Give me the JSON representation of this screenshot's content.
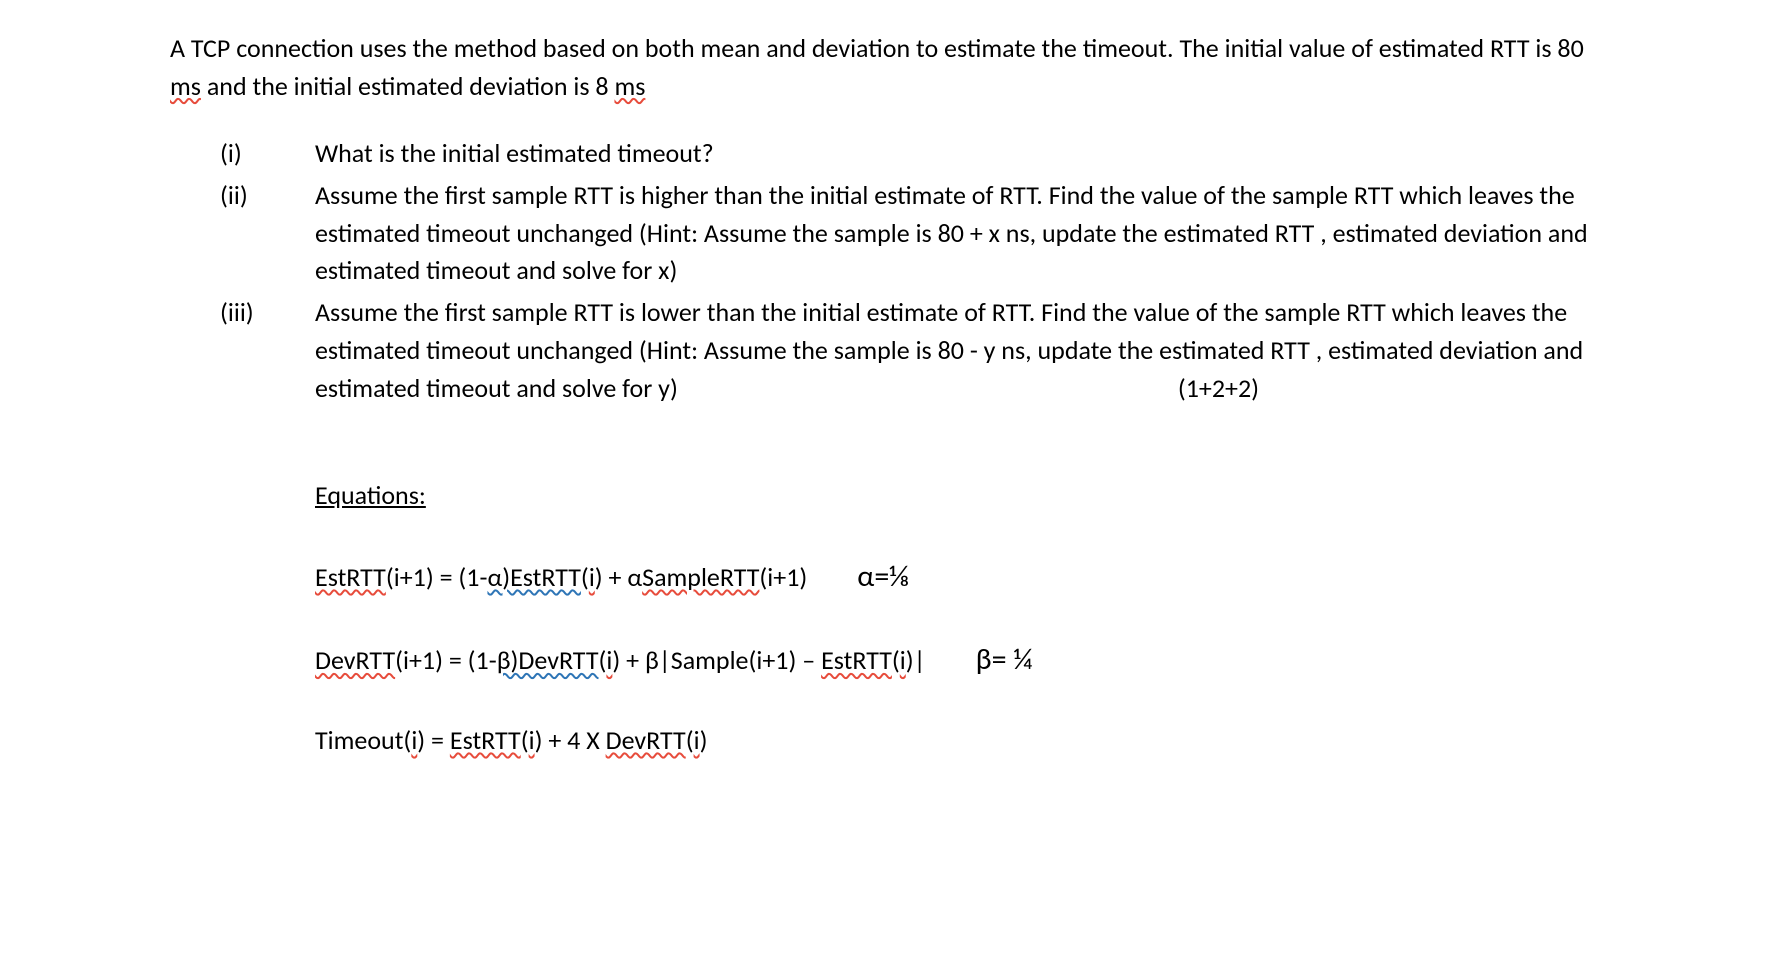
{
  "intro_part1": "A TCP connection uses the method based on both mean and deviation to estimate the timeout. The initial value of estimated RTT is 80 ",
  "intro_ms1": "ms",
  "intro_part2": " and the initial estimated deviation is 8 ",
  "intro_ms2": "ms",
  "questions": {
    "i": {
      "label": "(i)",
      "text": "What is the initial estimated timeout?"
    },
    "ii": {
      "label": "(ii)",
      "text": "Assume the first sample RTT is higher than the initial estimate of RTT. Find the value of the sample RTT which leaves the estimated timeout unchanged (Hint: Assume the sample is 80 + x ns, update the estimated RTT , estimated deviation  and estimated timeout and solve for x)"
    },
    "iii": {
      "label": "(iii)",
      "text_part1": " Assume the first sample RTT is lower than the initial estimate of RTT. Find the value of the sample RTT which leaves the estimated timeout unchanged (Hint: Assume the sample is 80 - y ns, update the estimated RTT , estimated deviation  and estimated timeout and solve for y)",
      "marks": "(1+2+2)"
    }
  },
  "equations": {
    "heading": "Equations:",
    "eq1": {
      "p1": "EstRTT",
      "p2": "(i+1) = (1-",
      "p3": "α)EstRTT",
      "p4": "(",
      "p5": "i",
      "p6": ") + α",
      "p7": "SampleRTT",
      "p8": "(i+1)",
      "param": "α=⅛"
    },
    "eq2": {
      "p1": "DevRTT",
      "p2": "(i+1) = (1-",
      "p3": "β)DevRTT",
      "p4": "(",
      "p5": "i",
      "p6": ") + β|Sample(i+1) – ",
      "p7": "EstRTT",
      "p8": "(",
      "p9": "i",
      "p10": ")|",
      "param": "β= ¼"
    },
    "eq3": {
      "p1": "Timeout(",
      "p2": "i",
      "p3": ") = ",
      "p4": "EstRTT",
      "p5": "(",
      "p6": "i",
      "p7": ") + 4 X ",
      "p8": "DevRTT",
      "p9": "(",
      "p10": "i",
      "p11": ")"
    }
  }
}
